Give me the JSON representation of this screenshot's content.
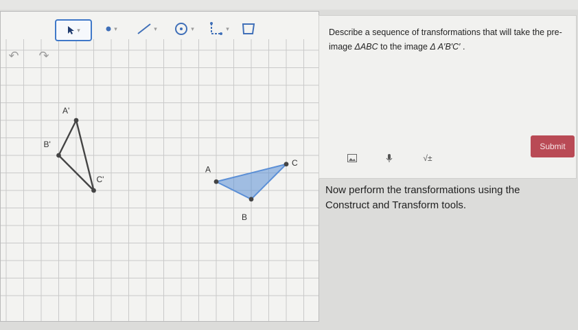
{
  "toolbar": {
    "tools": [
      {
        "name": "select-tool",
        "icon": "arrow-pointer-icon",
        "selected": true
      },
      {
        "name": "point-tool",
        "icon": "point-icon"
      },
      {
        "name": "segment-tool",
        "icon": "segment-icon"
      },
      {
        "name": "circle-tool",
        "icon": "circle-icon"
      },
      {
        "name": "transform-tool",
        "icon": "transform-icon"
      },
      {
        "name": "polygon-tool",
        "icon": "polygon-icon"
      }
    ]
  },
  "graph": {
    "points": [
      {
        "label": "A'",
        "x": 4,
        "y": 10
      },
      {
        "label": "B'",
        "x": 3,
        "y": 8
      },
      {
        "label": "C'",
        "x": 5,
        "y": 6
      },
      {
        "label": "A",
        "x": 12,
        "y": 6.5
      },
      {
        "label": "B",
        "x": 14,
        "y": 5.5
      },
      {
        "label": "C",
        "x": 16,
        "y": 7.5
      }
    ],
    "accent_color": "#5b8fd6"
  },
  "question": {
    "text_before": "Describe a sequence of transformations that will take the pre-image ",
    "preimage": "ΔABC",
    "text_middle": " to the image ",
    "image": "Δ A′B′C′",
    "text_after": " ."
  },
  "answer_toolbar": {
    "sqrt_label": "√±"
  },
  "submit_label": "Submit",
  "instruction": "Now perform the transformations using the Construct and Transform tools."
}
